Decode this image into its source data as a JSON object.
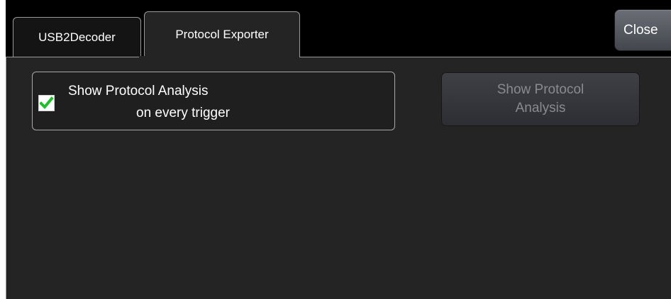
{
  "tabs": [
    {
      "label": "USB2Decoder",
      "active": false
    },
    {
      "label": "Protocol Exporter",
      "active": true
    }
  ],
  "close_button": {
    "label": "Close"
  },
  "show_analysis_checkbox": {
    "checked": true,
    "label_line1": "Show Protocol Analysis",
    "label_line2": "on every trigger"
  },
  "show_analysis_button": {
    "label_line1": "Show Protocol",
    "label_line2": "Analysis",
    "enabled": false
  },
  "colors": {
    "panel_background": "#242424",
    "checkmark": "#1fbf2a",
    "disabled_text": "#8a8b8e",
    "border": "#9a9a9a"
  }
}
